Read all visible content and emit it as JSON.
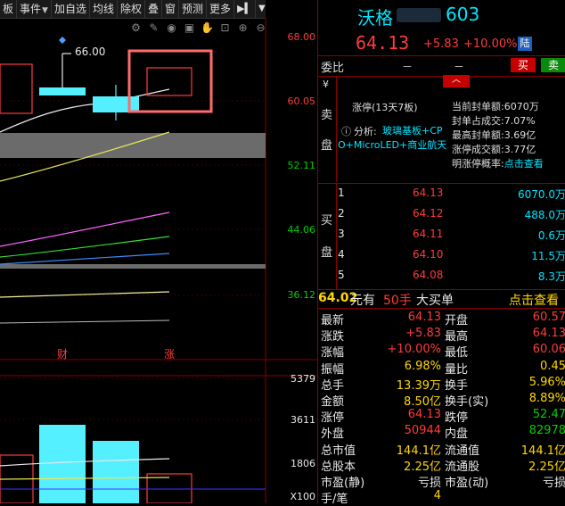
{
  "toolbar": {
    "items": [
      {
        "label": "板",
        "arrow": false
      },
      {
        "label": "事件",
        "arrow": true
      },
      {
        "label": "加自选",
        "arrow": false
      },
      {
        "label": "均线",
        "arrow": false
      },
      {
        "label": "除权",
        "arrow": false
      },
      {
        "label": "叠",
        "arrow": false
      },
      {
        "label": "窗",
        "arrow": false
      },
      {
        "label": "预测",
        "arrow": false
      },
      {
        "label": "更多",
        "arrow": false
      }
    ],
    "expand_icon": "expand-right-icon",
    "collapse_icon": "chevron-down-icon"
  },
  "chart": {
    "price_labels": [
      "68.00",
      "60.05",
      "52.11",
      "44.06",
      "36.12"
    ],
    "volume_labels": [
      "5379",
      "3611",
      "1806",
      "X100"
    ],
    "annotation_high": "66.00",
    "marker_cai": "财",
    "marker_zhang": "涨",
    "icons": [
      "gear-icon",
      "pen-icon",
      "eye-icon",
      "camera-icon",
      "hand-icon",
      "lock-icon",
      "plus-icon",
      "minus-icon"
    ]
  },
  "header": {
    "name": "沃格",
    "code": "603",
    "price": "64.13",
    "change": "+5.83",
    "pct": "+10.00%",
    "exchange_badge": "陆"
  },
  "weibi": {
    "label": "委比",
    "value1": "－",
    "value2": "－",
    "buy_btn": "买",
    "sell_btn": "卖"
  },
  "sell_side": {
    "label_chars": [
      "¥",
      "卖",
      "盘"
    ],
    "limit_title": "涨停(13天7板)",
    "analysis_prefix": "分析:",
    "analysis_text": "玻璃基板+CPO+MicroLED+商业航天",
    "stats": [
      {
        "k": "当前封单额:",
        "v": "6070万"
      },
      {
        "k": "封单占成交:",
        "v": "7.07%"
      },
      {
        "k": "最高封单额:",
        "v": "3.69亿"
      },
      {
        "k": "涨停成交额:",
        "v": "3.77亿"
      },
      {
        "k": "明涨停概率:",
        "v": "点击查看"
      }
    ]
  },
  "buy_side": {
    "label_chars": [
      "买",
      "盘"
    ],
    "levels": [
      {
        "n": "1",
        "price": "64.13",
        "vol": "6070.0万"
      },
      {
        "n": "2",
        "price": "64.12",
        "vol": "488.0万"
      },
      {
        "n": "3",
        "price": "64.11",
        "vol": "0.6万"
      },
      {
        "n": "4",
        "price": "64.10",
        "vol": "11.5万"
      },
      {
        "n": "5",
        "price": "64.08",
        "vol": "8.3万"
      }
    ]
  },
  "big_order": {
    "price": "64.02",
    "unit": "元有",
    "qty": "50手",
    "type": "大买单",
    "link": "点击查看"
  },
  "stats": [
    {
      "k1": "最新",
      "v1": "64.13",
      "c1": "red",
      "k2": "开盘",
      "v2": "60.57",
      "c2": "red"
    },
    {
      "k1": "涨跌",
      "v1": "+5.83",
      "c1": "red",
      "k2": "最高",
      "v2": "64.13",
      "c2": "red"
    },
    {
      "k1": "涨幅",
      "v1": "+10.00%",
      "c1": "red",
      "k2": "最低",
      "v2": "60.06",
      "c2": "red"
    },
    {
      "k1": "振幅",
      "v1": "6.98%",
      "c1": "yel",
      "k2": "量比",
      "v2": "0.45",
      "c2": "yel"
    },
    {
      "k1": "总手",
      "v1": "13.39万",
      "c1": "yel",
      "k2": "换手",
      "v2": "5.96%",
      "c2": "yel"
    },
    {
      "k1": "金额",
      "v1": "8.50亿",
      "c1": "yel",
      "k2": "换手(实)",
      "v2": "8.89%",
      "c2": "yel"
    },
    {
      "k1": "涨停",
      "v1": "64.13",
      "c1": "red",
      "k2": "跌停",
      "v2": "52.47",
      "c2": "grn"
    },
    {
      "k1": "外盘",
      "v1": "50944",
      "c1": "red",
      "k2": "内盘",
      "v2": "82978",
      "c2": "grn"
    },
    {
      "k1": "总市值",
      "v1": "144.1亿",
      "c1": "yel",
      "k2": "流通值",
      "v2": "144.1亿",
      "c2": "yel"
    },
    {
      "k1": "总股本",
      "v1": "2.25亿",
      "c1": "yel",
      "k2": "流通股",
      "v2": "2.25亿",
      "c2": "yel"
    },
    {
      "k1": "市盈(静)",
      "v1": "亏损",
      "c1": "wht",
      "k2": "市盈(动)",
      "v2": "亏损",
      "c2": "wht"
    },
    {
      "k1": "手/笔",
      "v1": "4",
      "c1": "yel",
      "k2": "",
      "v2": "",
      "c2": "wht"
    }
  ]
}
